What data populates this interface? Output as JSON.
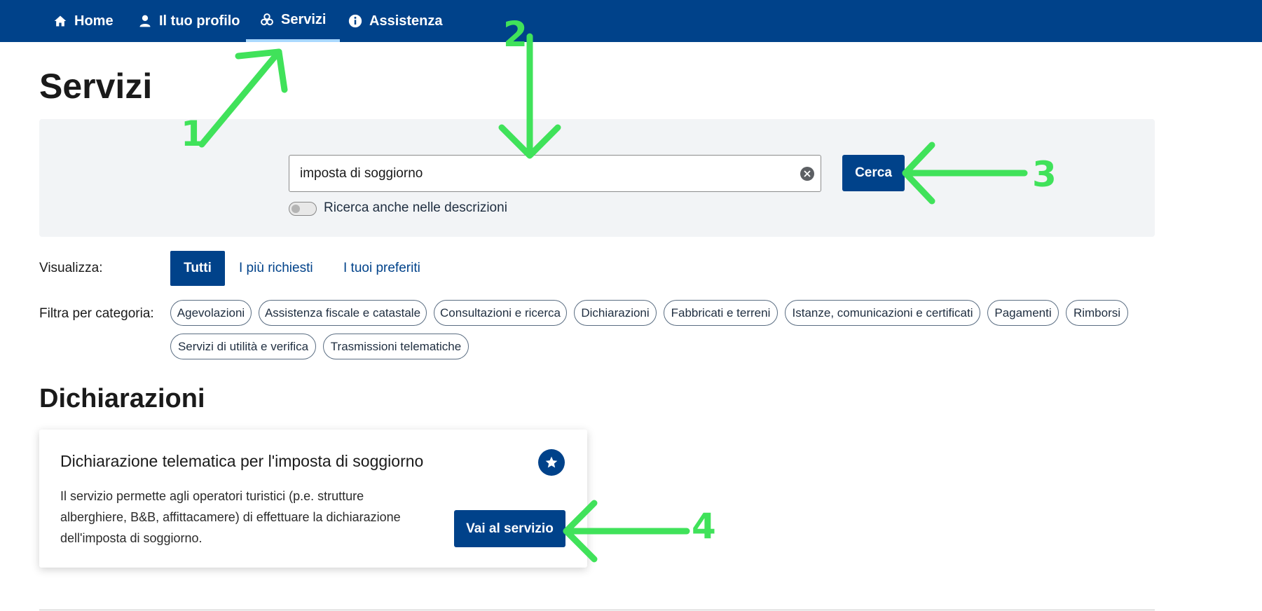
{
  "nav": {
    "items": [
      {
        "label": "Home",
        "icon": "home-icon"
      },
      {
        "label": "Il tuo profilo",
        "icon": "user-icon"
      },
      {
        "label": "Servizi",
        "icon": "services-icon"
      },
      {
        "label": "Assistenza",
        "icon": "info-icon"
      }
    ],
    "active": "Servizi"
  },
  "page": {
    "title": "Servizi"
  },
  "search": {
    "value": "imposta di soggiorno",
    "button_label": "Cerca",
    "toggle_label": "Ricerca anche nelle descrizioni",
    "toggle_on": false
  },
  "view": {
    "label": "Visualizza:",
    "tabs": [
      "Tutti",
      "I più richiesti",
      "I tuoi preferiti"
    ],
    "active": "Tutti"
  },
  "categories": {
    "label": "Filtra per categoria:",
    "chips": [
      "Agevolazioni",
      "Assistenza fiscale e catastale",
      "Consultazioni e ricerca",
      "Dichiarazioni",
      "Fabbricati e terreni",
      "Istanze, comunicazioni e certificati",
      "Pagamenti",
      "Rimborsi",
      "Servizi di utilità e verifica",
      "Trasmissioni telematiche"
    ]
  },
  "section": {
    "title": "Dichiarazioni"
  },
  "card": {
    "title": "Dichiarazione telematica per l'imposta di soggiorno",
    "description": "Il servizio permette agli operatori turistici (p.e. strutture alberghiere, B&B, affittacamere) di effettuare la dichiarazione dell'imposta di soggiorno.",
    "button_label": "Vai al servizio",
    "favorite_icon": "star-icon"
  },
  "annotations": {
    "labels": [
      "1",
      "2",
      "3",
      "4"
    ],
    "color": "#40e25a"
  },
  "colors": {
    "primary": "#00428a",
    "panel": "#f2f4f6",
    "active_underline": "#a9d8ff"
  }
}
